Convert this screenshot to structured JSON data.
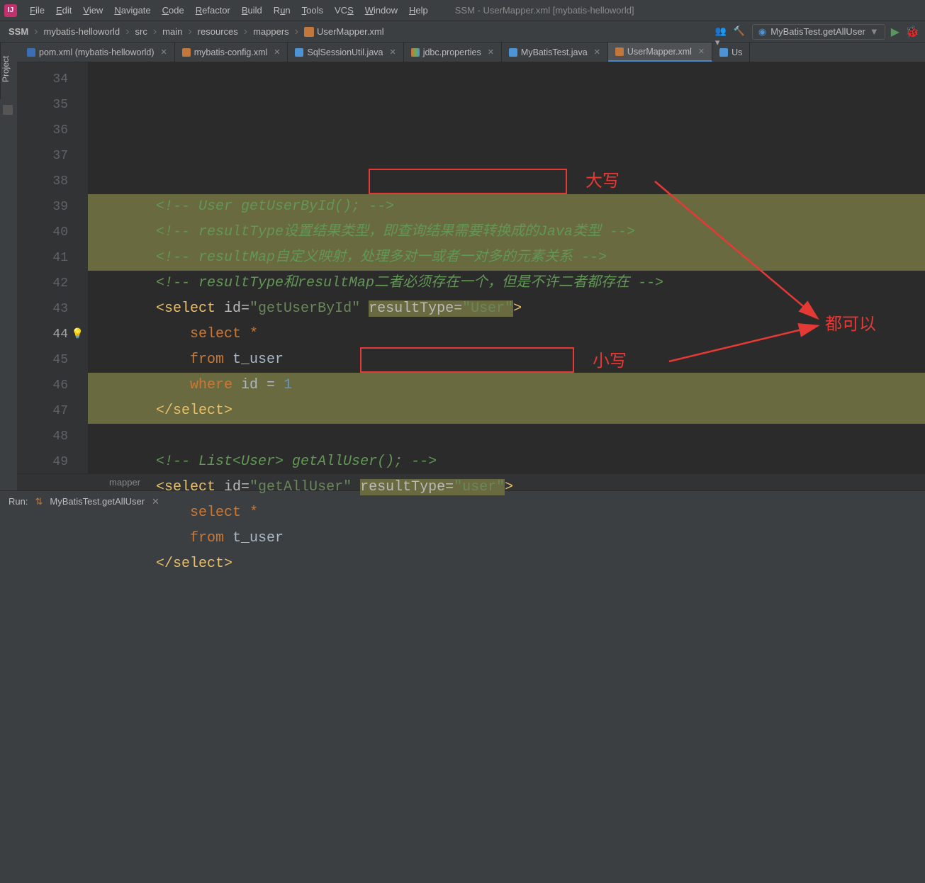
{
  "menu": {
    "items": [
      "File",
      "Edit",
      "View",
      "Navigate",
      "Code",
      "Refactor",
      "Build",
      "Run",
      "Tools",
      "VCS",
      "Window",
      "Help"
    ]
  },
  "window_title": "SSM - UserMapper.xml [mybatis-helloworld]",
  "breadcrumbs": [
    "SSM",
    "mybatis-helloworld",
    "src",
    "main",
    "resources",
    "mappers",
    "UserMapper.xml"
  ],
  "run_config": "MyBatisTest.getAllUser",
  "tabs": [
    {
      "label": "pom.xml (mybatis-helloworld)",
      "icon": "t-m",
      "active": false
    },
    {
      "label": "mybatis-config.xml",
      "icon": "t-x",
      "active": false
    },
    {
      "label": "SqlSessionUtil.java",
      "icon": "t-c",
      "active": false
    },
    {
      "label": "jdbc.properties",
      "icon": "t-p",
      "active": false
    },
    {
      "label": "MyBatisTest.java",
      "icon": "t-c",
      "active": false
    },
    {
      "label": "UserMapper.xml",
      "icon": "t-x",
      "active": true
    },
    {
      "label": "Us",
      "icon": "t-c",
      "active": false
    }
  ],
  "side_label": "Project",
  "gutter": [
    "34",
    "35",
    "36",
    "37",
    "38",
    "39",
    "40",
    "41",
    "42",
    "43",
    "44",
    "45",
    "46",
    "47",
    "48",
    "49"
  ],
  "code": {
    "l34": "<!-- User getUserById(); -->",
    "l35": "<!-- resultType设置结果类型，即查询结果需要转换成的Java类型 -->",
    "l36": "<!-- resultMap自定义映射，处理多对一或者一对多的元素关系 -->",
    "l37": "<!-- resultType和resultMap二者必须存在一个，但是不许二者都存在 -->",
    "l38_a": "<select ",
    "l38_b": "id=",
    "l38_c": "\"getUserById\" ",
    "l38_d": "resultType=",
    "l38_e": "\"User\"",
    "l38_f": ">",
    "l39": "select *",
    "l40": "from t_user",
    "l41": "where id = 1",
    "l42": "</select>",
    "l43": "",
    "l44": "<!-- List<User> getAllUser(); -->",
    "l45_a": "<select ",
    "l45_b": "id=",
    "l45_c": "\"getAllUser\" ",
    "l45_d": "resultType=",
    "l45_e": "\"user\"",
    "l45_f": ">",
    "l46": "select *",
    "l47": "from t_user",
    "l48": "</select>"
  },
  "annotations": {
    "upper": "大写",
    "lower": "小写",
    "both": "都可以"
  },
  "code_crumb": "mapper",
  "run_panel": {
    "label": "Run:",
    "config": "MyBatisTest.getAllUser"
  }
}
